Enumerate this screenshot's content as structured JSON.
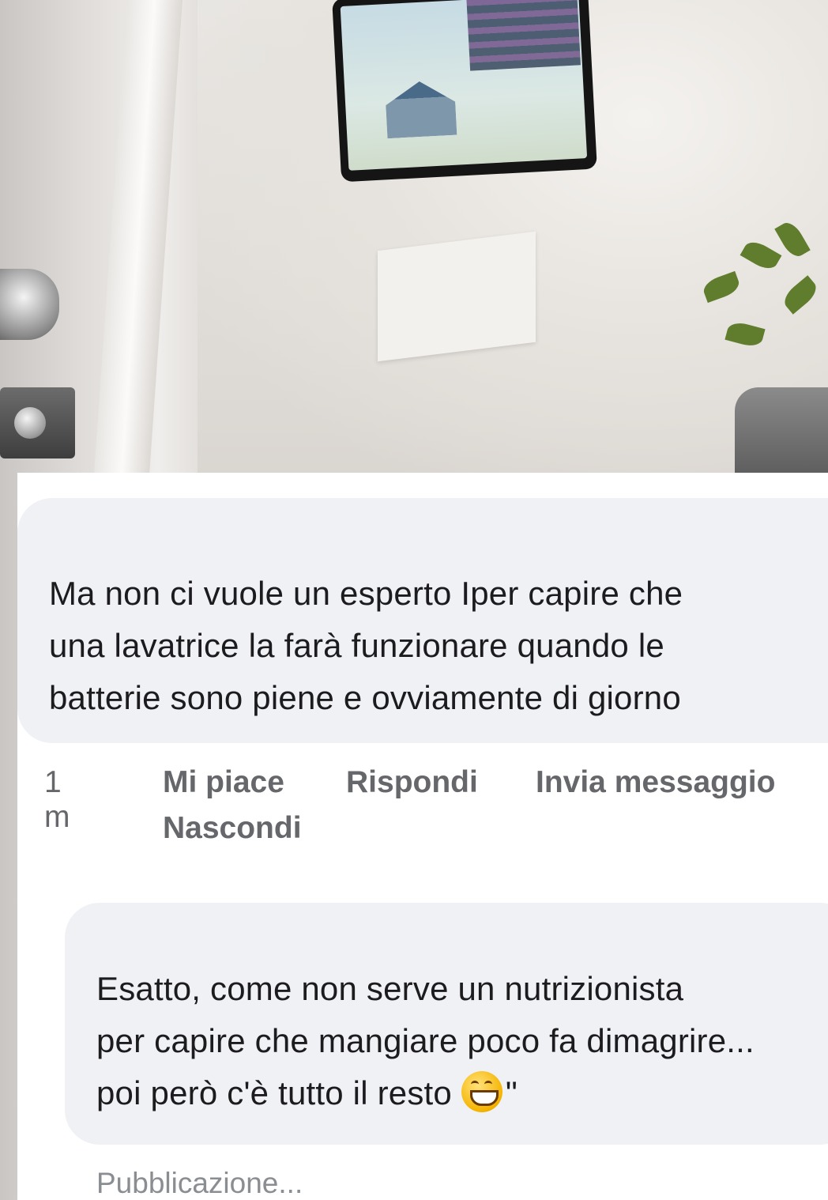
{
  "comment": {
    "text": "Ma non ci vuole un esperto Iper capire che\nuna lavatrice la farà  funzionare quando le\nbatterie sono piene e ovviamente  di giorno",
    "time": "1 m",
    "actions": {
      "like": "Mi piace",
      "reply": "Rispondi",
      "message": "Invia messaggio",
      "hide": "Nascondi"
    }
  },
  "reply": {
    "text_before_emoji": "Esatto, come non serve un nutrizionista\nper capire che mangiare poco fa dimagrire...\npoi però c'è tutto il resto ",
    "emoji": "grinning-face-emoji",
    "text_after_emoji": "\"",
    "status": "Pubblicazione..."
  },
  "colors": {
    "bubble": "#f0f1f5",
    "text": "#1c1c1e",
    "meta": "#65676b",
    "status": "#8a8d91"
  }
}
